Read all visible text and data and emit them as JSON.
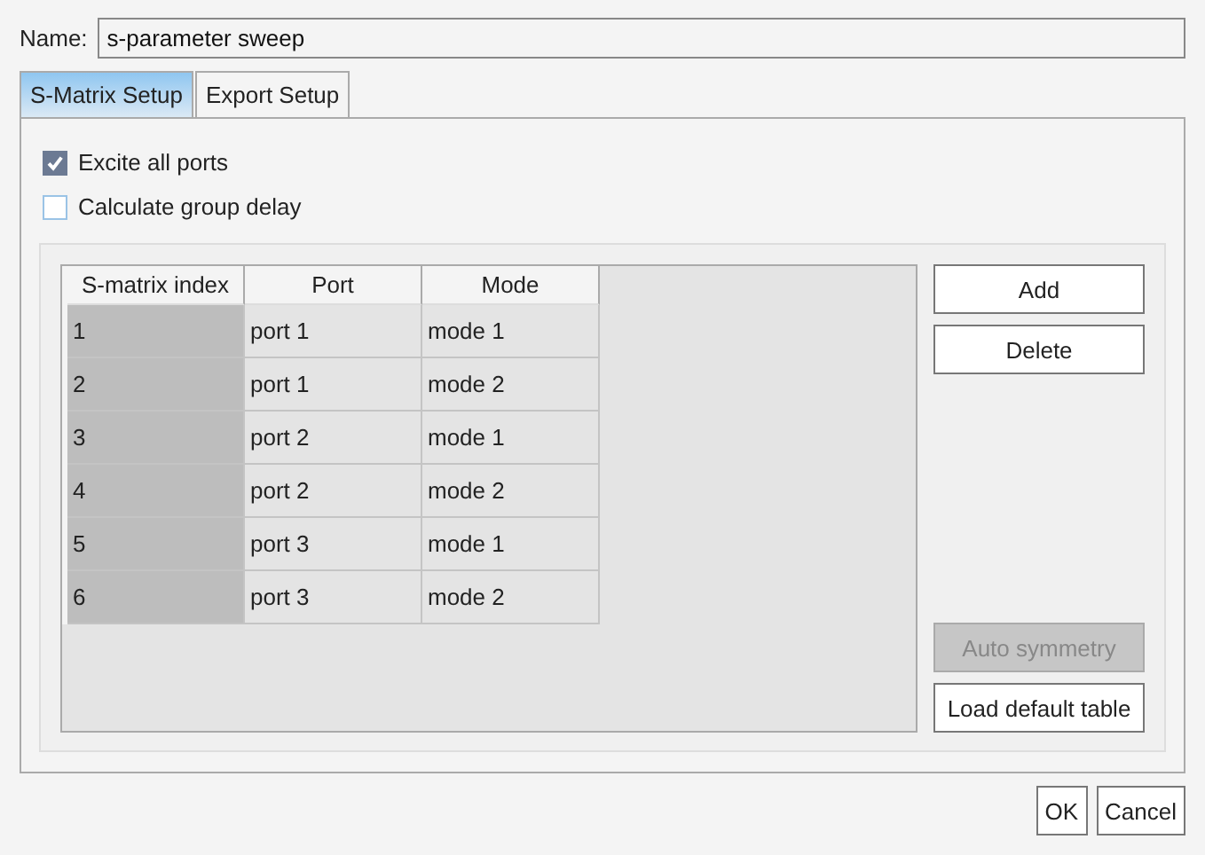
{
  "name_field": {
    "label": "Name:",
    "value": "s-parameter sweep"
  },
  "tabs": [
    {
      "label": "S-Matrix Setup",
      "selected": true
    },
    {
      "label": "Export Setup",
      "selected": false
    }
  ],
  "options": [
    {
      "label": "Excite all ports",
      "checked": true
    },
    {
      "label": "Calculate group delay",
      "checked": false
    }
  ],
  "table": {
    "columns": [
      "S-matrix index",
      "Port",
      "Mode"
    ],
    "rows": [
      [
        "1",
        "port 1",
        "mode 1"
      ],
      [
        "2",
        "port 1",
        "mode 2"
      ],
      [
        "3",
        "port 2",
        "mode 1"
      ],
      [
        "4",
        "port 2",
        "mode 2"
      ],
      [
        "5",
        "port 3",
        "mode 1"
      ],
      [
        "6",
        "port 3",
        "mode 2"
      ]
    ]
  },
  "side_buttons": [
    {
      "label": "Add",
      "disabled": false
    },
    {
      "label": "Delete",
      "disabled": false
    },
    {
      "label": "Auto symmetry",
      "disabled": true
    },
    {
      "label": "Load default table",
      "disabled": false
    }
  ],
  "footer_buttons": [
    "OK",
    "Cancel"
  ]
}
